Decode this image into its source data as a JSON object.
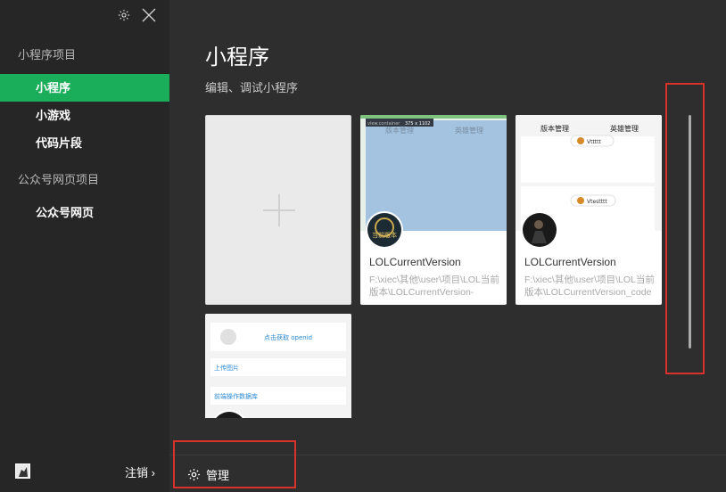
{
  "sidebar": {
    "section_miniapp": "小程序项目",
    "items": [
      {
        "label": "小程序"
      },
      {
        "label": "小游戏"
      },
      {
        "label": "代码片段"
      }
    ],
    "section_web": "公众号网页项目",
    "web_item": "公众号网页",
    "logout_label": "注销 ›"
  },
  "main": {
    "title": "小程序",
    "subtitle": "编辑、调试小程序",
    "projects": [
      {
        "name": "LOLCurrentVersion",
        "path": "F:\\xiec\\其他\\user\\项目\\LOL当前版本\\LOLCurrentVersion-",
        "thumb_tabs": [
          "版本管理",
          "英雄管理"
        ],
        "thumb_tag": "view.container",
        "thumb_size": "375 x 1102",
        "avatar_text": "当前版本"
      },
      {
        "name": "LOLCurrentVersion",
        "path": "F:\\xiec\\其他\\user\\项目\\LOL当前版本\\LOLCurrentVersion_code",
        "thumb_tabs": [
          "版本管理",
          "英雄管理"
        ],
        "thumb_items": [
          "Vttttt",
          "Vtestttt"
        ]
      },
      {
        "thumb_items": [
          "点击获取 openid",
          "上传图片",
          "前端操作数据库"
        ]
      }
    ],
    "footer": {
      "manage_label": "管理"
    }
  },
  "colors": {
    "accent": "#1aad5a",
    "sidebar_bg": "#262626",
    "main_bg": "#2e2e2e",
    "highlight_box": "#d9322b"
  }
}
